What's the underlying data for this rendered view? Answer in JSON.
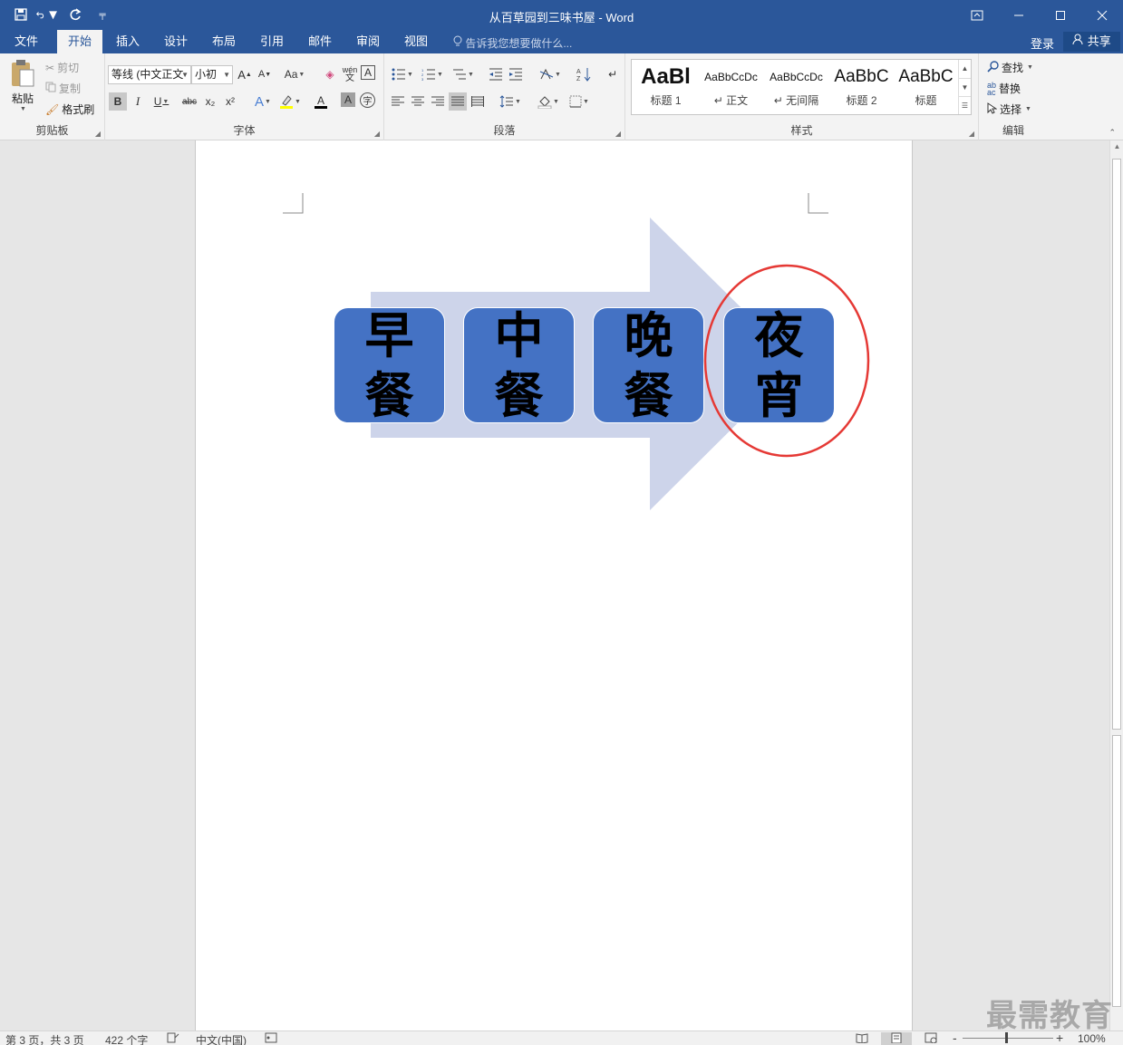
{
  "titlebar": {
    "title": "从百草园到三味书屋 - Word",
    "qat": {
      "save_icon": "save-icon",
      "undo_icon": "undo-icon",
      "redo_icon": "redo-icon",
      "customize_icon": "customize-icon"
    },
    "buttons": {
      "ribbon_display": "ribbon-display-options-icon",
      "minimize": "minimize-icon",
      "maximize": "maximize-icon",
      "close": "close-icon"
    }
  },
  "menu": {
    "tabs": [
      "文件",
      "开始",
      "插入",
      "设计",
      "布局",
      "引用",
      "邮件",
      "审阅",
      "视图"
    ],
    "active_tab": "开始",
    "tell_me": "告诉我您想要做什么...",
    "login": "登录",
    "share": "共享"
  },
  "ribbon": {
    "clipboard": {
      "label": "剪贴板",
      "paste": "粘贴",
      "cut": "剪切",
      "copy": "复制",
      "format_painter": "格式刷"
    },
    "font": {
      "label": "字体",
      "font_name": "等线 (中文正文",
      "font_size": "小初",
      "grow": "A",
      "shrink": "A",
      "change_case": "Aa",
      "bold": "B",
      "italic": "I",
      "underline": "U",
      "strikethrough": "abc",
      "subscript": "x₂",
      "superscript": "x²",
      "font_color": "A",
      "char_shading": "A",
      "phonetic": "wén",
      "char_border": "A"
    },
    "paragraph": {
      "label": "段落"
    },
    "styles": {
      "label": "样式",
      "items": [
        {
          "sample": "AaBl",
          "name": "标题 1"
        },
        {
          "sample": "AaBbCcDc",
          "name": "↵ 正文"
        },
        {
          "sample": "AaBbCcDc",
          "name": "↵ 无间隔"
        },
        {
          "sample": "AaBbC",
          "name": "标题 2"
        },
        {
          "sample": "AaBbC",
          "name": "标题"
        }
      ]
    },
    "editing": {
      "label": "编辑",
      "find": "查找",
      "replace": "替换",
      "select": "选择"
    }
  },
  "document": {
    "diagram": {
      "items": [
        {
          "top": "早",
          "bottom": "餐"
        },
        {
          "top": "中",
          "bottom": "餐"
        },
        {
          "top": "晚",
          "bottom": "餐"
        },
        {
          "top": "夜",
          "bottom": "宵"
        }
      ],
      "tile_color": "#4472c4",
      "arrow_color": "#cdd4ea",
      "highlight_color": "#e53935"
    }
  },
  "watermark": "最需教育",
  "status": {
    "page": "第 3 页，共 3 页",
    "words": "422 个字",
    "language": "中文(中国)",
    "zoom": "100%",
    "zoom_minus": "-",
    "zoom_plus": "+"
  }
}
